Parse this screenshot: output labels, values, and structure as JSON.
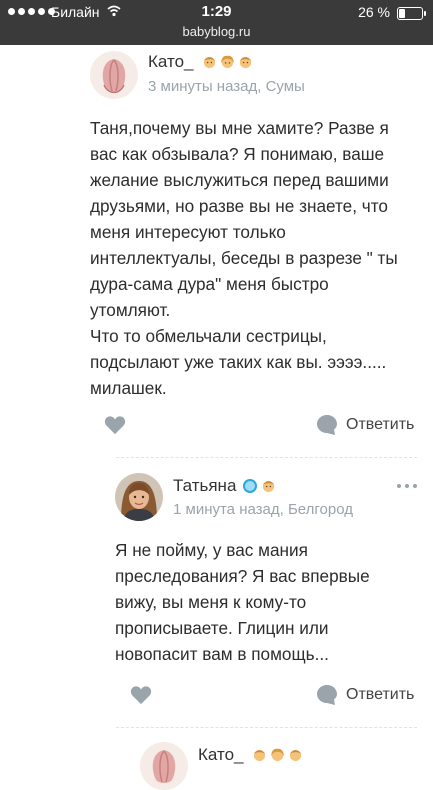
{
  "status_bar": {
    "carrier": "Билайн",
    "time": "1:29",
    "battery_percent": "26 %",
    "battery_level": 0.26
  },
  "browser": {
    "url": "babyblog.ru"
  },
  "comments": [
    {
      "author": "Като_",
      "meta": "3 минуты назад, Сумы",
      "text": "Таня,почему вы мне хамите? Разве я\nвас как обзывала? Я понимаю, ваше\nжелание выслужиться перед вашими\nдрузьями, но разве вы не знаете, что\nменя интересуют только\nинтеллектуалы, беседы в разрезе \" ты\nдура-сама дура\" меня быстро\nутомляют.\nЧто то обмельчали сестрицы,\nподсылают уже таких как вы. ээээ.....\nмилашек.",
      "reply_label": "Ответить"
    },
    {
      "author": "Татьяна",
      "meta": "1 минута назад, Белгород",
      "text": "Я не пойму, у вас мания\nпреследования? Я вас впервые\nвижу, вы меня к кому-то\nпрописываете. Глицин или\nновопасит вам в помощь...",
      "reply_label": "Ответить"
    },
    {
      "author": "Като_"
    }
  ],
  "icons": {
    "like": "heart-icon",
    "reply": "speech-bubble-icon",
    "more": "more-dots-icon",
    "badges": [
      "boy-child-icon",
      "girl-child-icon",
      "boy-child-icon"
    ]
  },
  "colors": {
    "top_bar": "#3a3a3a",
    "icon_grey": "#9aa4ab",
    "meta_text": "#9aa4ab",
    "online_badge": "#2ea7d9"
  }
}
